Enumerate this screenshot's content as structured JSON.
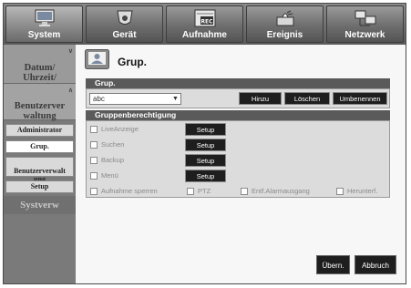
{
  "topnav": {
    "tabs": [
      {
        "label": "System",
        "icon": "monitor-icon",
        "active": true
      },
      {
        "label": "Gerät",
        "icon": "camera-icon",
        "active": false
      },
      {
        "label": "Aufnahme",
        "icon": "rec-icon",
        "active": false
      },
      {
        "label": "Ereignis",
        "icon": "alarm-icon",
        "active": false
      },
      {
        "label": "Netzwerk",
        "icon": "network-icon",
        "active": false
      }
    ]
  },
  "sidebar": {
    "datum": "Datum/\nUhrzeit/\nSprache",
    "benutzer": "Benutzerver\nwaltung",
    "subs": [
      {
        "label": "Administrator"
      },
      {
        "label": "Grup."
      },
      {
        "label": "Benutzerverwalt\nung"
      },
      {
        "label": "Setup"
      }
    ],
    "systemverw": "Systverw"
  },
  "content": {
    "title": "Grup.",
    "group_header": "Grup.",
    "group_value": "abc",
    "buttons": {
      "add": "Hinzu",
      "delete": "Löschen",
      "rename": "Umbenennen"
    },
    "perm_header": "Gruppenberechtigung",
    "perms": [
      {
        "label": "LiveAnzeige",
        "setup": "Setup"
      },
      {
        "label": "Suchen",
        "setup": "Setup"
      },
      {
        "label": "Backup",
        "setup": "Setup"
      },
      {
        "label": "Menü",
        "setup": "Setup"
      }
    ],
    "extra_perms": [
      "Aufnahme sperren",
      "PTZ",
      "Entf.Alarmausgang",
      "Herunterf."
    ],
    "ok_button": "Übern.",
    "cancel_button": "Abbruch"
  }
}
